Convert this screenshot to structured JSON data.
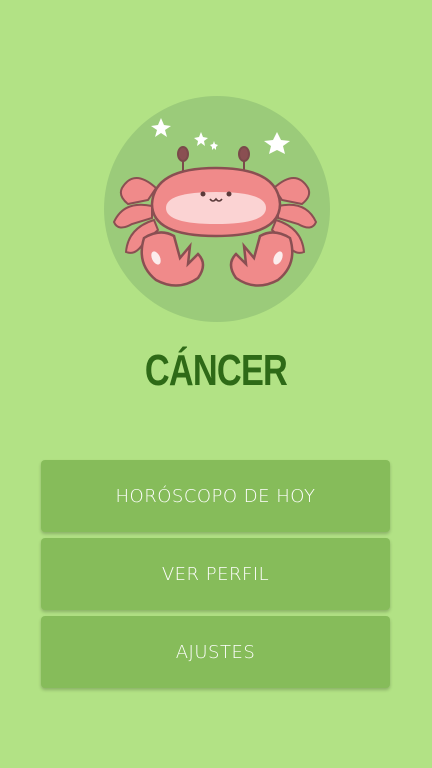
{
  "sign": {
    "name": "CÁNCER",
    "image_icon": "crab-icon"
  },
  "menu": {
    "items": [
      {
        "label": "HORÓSCOPO DE HOY",
        "icon": ""
      },
      {
        "label": "VER PERFIL",
        "icon": ""
      },
      {
        "label": "AJUSTES",
        "icon": ""
      }
    ]
  },
  "colors": {
    "background": "#b2e285",
    "circle": "#9bcb7a",
    "title": "#2e6a17",
    "button": "#86bc5a",
    "button_text": "#ffffff",
    "crab": "#f08a8a"
  }
}
